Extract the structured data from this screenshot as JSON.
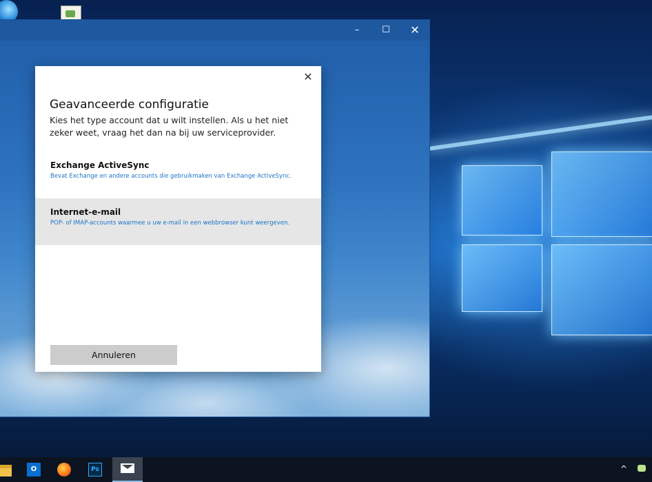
{
  "window": {
    "minimize_glyph": "–",
    "maximize_glyph": "☐",
    "close_glyph": "✕"
  },
  "dialog": {
    "close_glyph": "✕",
    "title": "Geavanceerde configuratie",
    "description": "Kies het type account dat u wilt instellen. Als u het niet zeker weet, vraag het dan na bij uw serviceprovider.",
    "options": [
      {
        "title": "Exchange ActiveSync",
        "description": "Bevat Exchange en andere accounts die gebruikmaken van Exchange ActiveSync."
      },
      {
        "title": "Internet-e-mail",
        "description": "POP- of IMAP-accounts waarmee u uw e-mail in een webbrowser kunt weergeven."
      }
    ],
    "cancel_label": "Annuleren"
  },
  "taskbar": {
    "items": [
      "file-explorer-icon",
      "outlook-icon",
      "firefox-icon",
      "photoshop-icon",
      "mail-icon"
    ],
    "outlook_glyph": "O",
    "photoshop_glyph": "Ps",
    "tray_chevron": "^"
  },
  "colors": {
    "accent": "#1b73c7",
    "selected_option_bg": "#e6e6e6",
    "cancel_button_bg": "#cccccc"
  }
}
